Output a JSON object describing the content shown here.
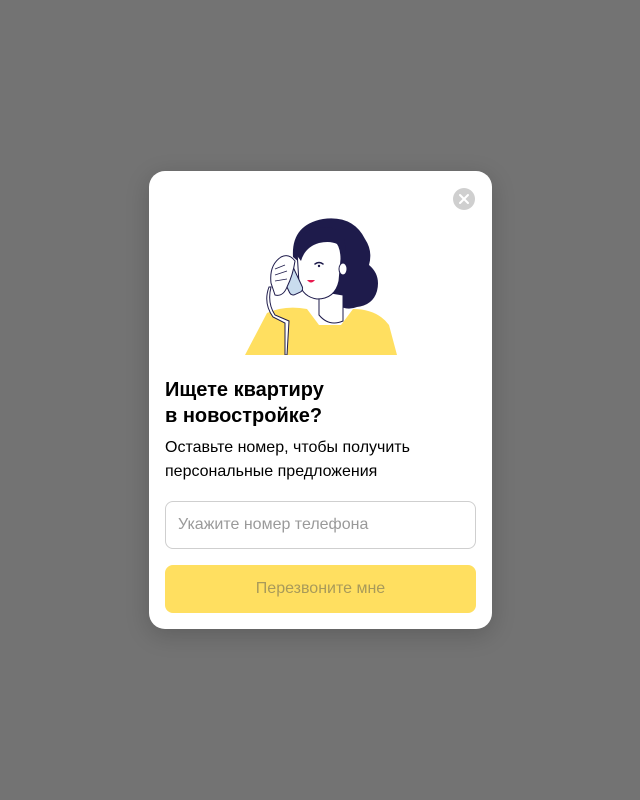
{
  "colors": {
    "backdrop": "#737373",
    "card": "#ffffff",
    "accent_yellow": "#ffdf60",
    "button_text_disabled": "#a89a5a",
    "hair": "#1e1b4b",
    "lips": "#e8194f",
    "close_bg": "#cfcfcf"
  },
  "modal": {
    "close_icon": "close-icon",
    "illustration": "woman-on-phone-illustration",
    "title_line1": "Ищете квартиру",
    "title_line2": "в новостройке?",
    "subtitle_line1": "Оставьте номер, чтобы получить",
    "subtitle_line2": "персональные предложения",
    "phone_field": {
      "value": "",
      "placeholder": "Укажите номер телефона"
    },
    "callback_button_label": "Перезвоните мне"
  }
}
